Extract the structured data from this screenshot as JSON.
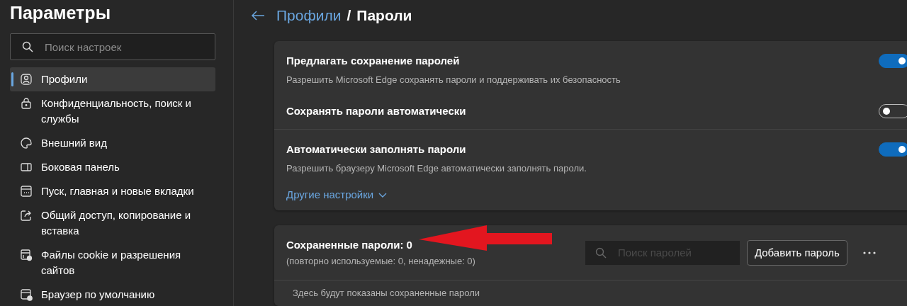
{
  "sidebar": {
    "title": "Параметры",
    "search": {
      "placeholder": "Поиск настроек"
    },
    "items": [
      {
        "label": "Профили",
        "selected": true
      },
      {
        "label": "Конфиденциальность, поиск и службы",
        "selected": false
      },
      {
        "label": "Внешний вид",
        "selected": false
      },
      {
        "label": "Боковая панель",
        "selected": false
      },
      {
        "label": "Пуск, главная и новые вкладки",
        "selected": false
      },
      {
        "label": "Общий доступ, копирование и вставка",
        "selected": false
      },
      {
        "label": "Файлы cookie и разрешения сайтов",
        "selected": false
      },
      {
        "label": "Браузер по умолчанию",
        "selected": false
      }
    ]
  },
  "breadcrumb": {
    "link": "Профили",
    "separator": "/",
    "current": "Пароли"
  },
  "settings": [
    {
      "title": "Предлагать сохранение паролей",
      "description": "Разрешить Microsoft Edge сохранять пароли и поддерживать их безопасность",
      "on": true,
      "divider": false
    },
    {
      "title": "Сохранять пароли автоматически",
      "on": false,
      "divider": true
    },
    {
      "title": "Автоматически заполнять пароли",
      "description": "Разрешить браузеру Microsoft Edge автоматически заполнять пароли.",
      "on": true,
      "divider": false
    }
  ],
  "more_settings": "Другие настройки",
  "saved": {
    "title": "Сохраненные пароли: 0",
    "subtitle": "(повторно используемые: 0, ненадежные: 0)",
    "search": {
      "placeholder": "Поиск паролей"
    },
    "add_button": "Добавить пароль",
    "empty_text": "Здесь будут показаны сохраненные пароли"
  }
}
